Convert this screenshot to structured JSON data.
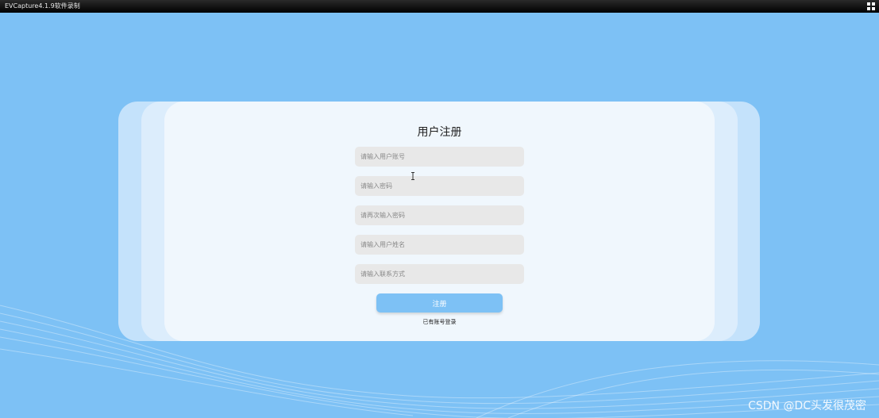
{
  "window": {
    "title": "EVCapture4.1.9软件录制",
    "button_icon": "grid-icon"
  },
  "form": {
    "title": "用户注册",
    "fields": [
      {
        "placeholder": "请输入用户账号",
        "value": ""
      },
      {
        "placeholder": "请输入密码",
        "value": ""
      },
      {
        "placeholder": "请再次输入密码",
        "value": ""
      },
      {
        "placeholder": "请输入用户姓名",
        "value": ""
      },
      {
        "placeholder": "请输入联系方式",
        "value": ""
      }
    ],
    "submit_label": "注册",
    "login_link": "已有账号登录"
  },
  "watermark": "CSDN @DC头发很茂密",
  "colors": {
    "background": "#7dc1f5",
    "card": "#f0f7fd",
    "field": "#e8e8e8",
    "button": "#7dc1f5"
  }
}
